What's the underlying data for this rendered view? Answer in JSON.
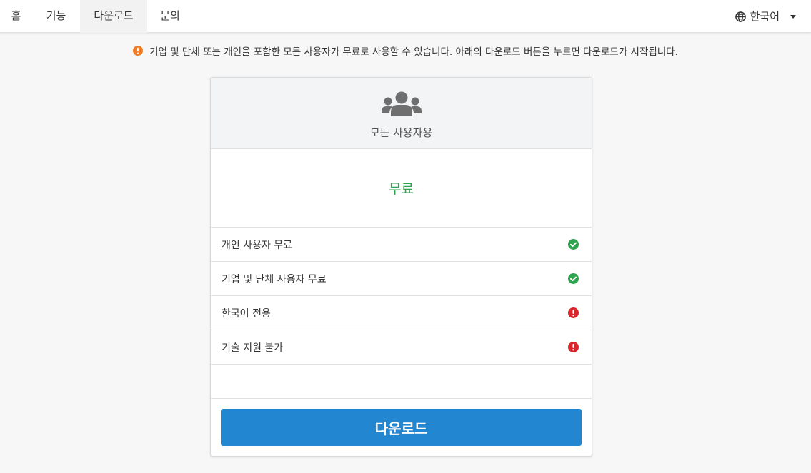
{
  "nav": {
    "items": [
      {
        "label": "홈"
      },
      {
        "label": "기능"
      },
      {
        "label": "다운로드"
      },
      {
        "label": "문의"
      }
    ],
    "active_index": 2,
    "language": {
      "label": "한국어",
      "icon": "globe-icon"
    }
  },
  "notice": {
    "icon": "exclamation-circle-icon",
    "color": "#f07b22",
    "text": "기업 및 단체 또는 개인을 포함한 모든 사용자가 무료로 사용할 수 있습니다. 아래의 다운로드 버튼을 누르면 다운로드가 시작됩니다."
  },
  "plan": {
    "icon": "users-icon",
    "title": "모든 사용자용",
    "price": "무료",
    "features": [
      {
        "label": "개인 사용자 무료",
        "status": "check",
        "icon": "check-circle-icon",
        "color": "#2ea44f"
      },
      {
        "label": "기업 및 단체 사용자 무료",
        "status": "check",
        "icon": "check-circle-icon",
        "color": "#2ea44f"
      },
      {
        "label": "한국어 전용",
        "status": "warning",
        "icon": "exclamation-circle-icon",
        "color": "#d9262c"
      },
      {
        "label": "기술 지원 불가",
        "status": "warning",
        "icon": "exclamation-circle-icon",
        "color": "#d9262c"
      }
    ],
    "download_label": "다운로드",
    "accent_color": "#2287d0"
  }
}
